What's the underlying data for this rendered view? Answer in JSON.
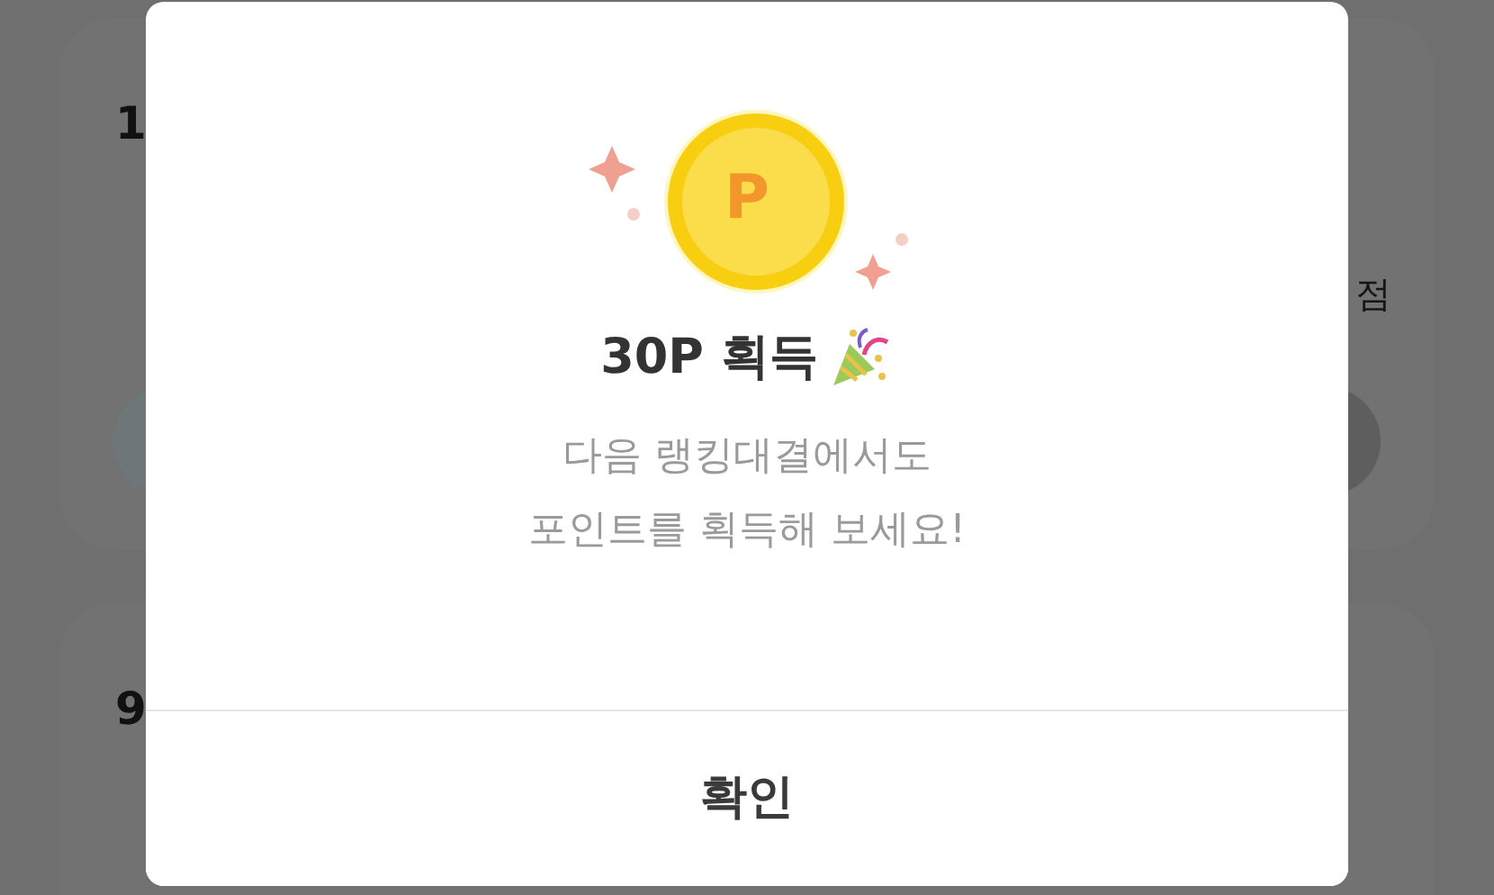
{
  "background_cards": [
    {
      "rank": "1",
      "score_suffix": "점"
    },
    {
      "rank": "9"
    }
  ],
  "dialog": {
    "coin_label": "P",
    "title": "30P 획득",
    "message_lines": [
      "다음 랭킹대결에서도",
      "포인트를 획득해 보세요!"
    ],
    "confirm_button": "확인"
  }
}
